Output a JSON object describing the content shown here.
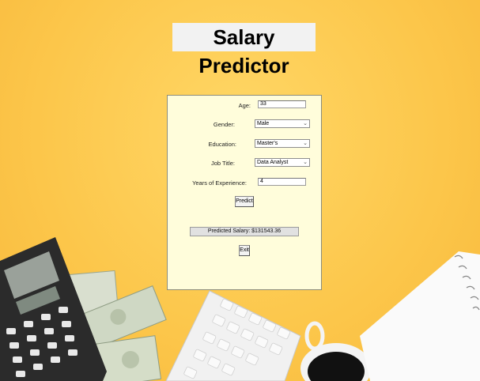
{
  "app": {
    "title": "Salary Predictor"
  },
  "form": {
    "age_label": "Age:",
    "age_value": "33",
    "gender_label": "Gender:",
    "gender_value": "Male",
    "education_label": "Education:",
    "education_value": "Master's",
    "job_title_label": "Job Title:",
    "job_title_value": "Data Analyst",
    "experience_label": "Years of Experience:",
    "experience_value": "4",
    "predict_label": "Predict",
    "result_text": "Predicted Salary: $131543.36",
    "exit_label": "Exit"
  },
  "colors": {
    "background": "#fcc64a",
    "panel": "#fffddb",
    "title_bg": "#f2f2f2"
  },
  "icons": {
    "dropdown": "chevron-down-icon"
  }
}
